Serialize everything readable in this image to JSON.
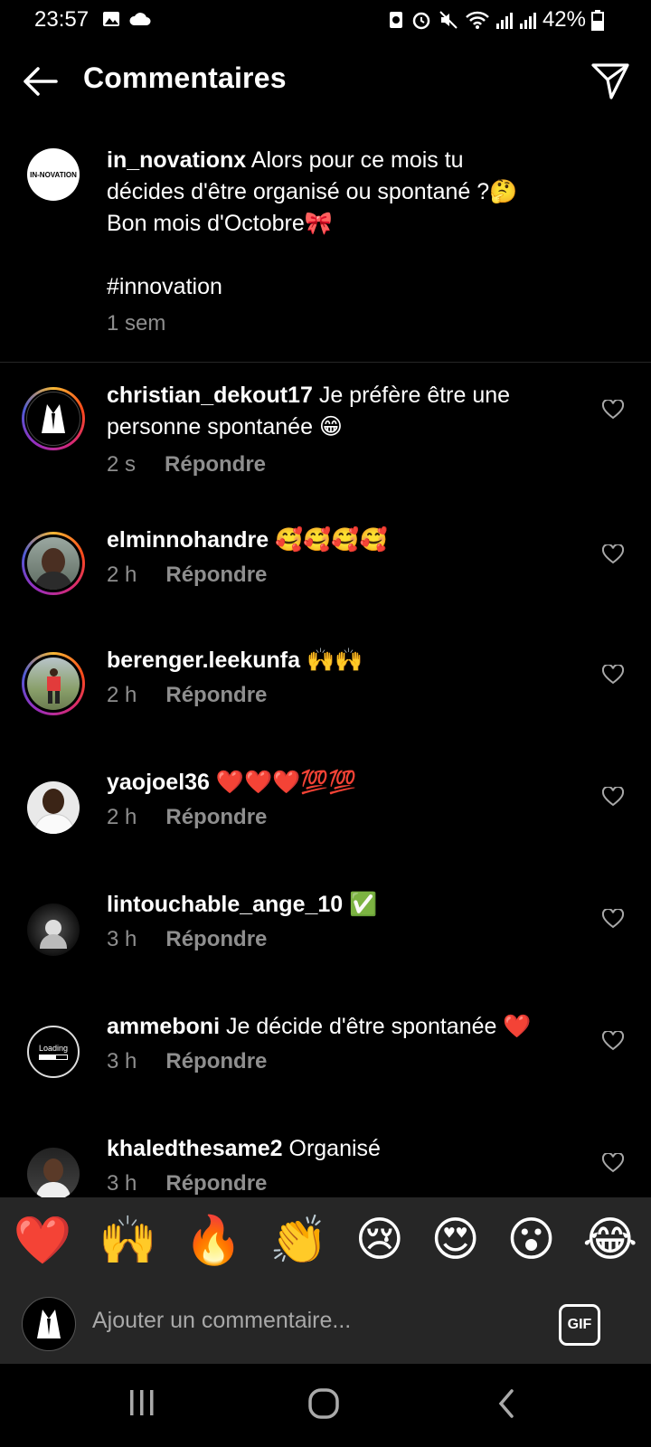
{
  "status_bar": {
    "time": "23:57",
    "battery": "42%"
  },
  "header": {
    "title": "Commentaires"
  },
  "caption": {
    "username": "in_novationx",
    "line1": "Alors pour ce mois tu",
    "line2": "décides d'être organisé ou spontané ?🤔",
    "line3": "Bon mois d'Octobre🎀",
    "hashtag": "#innovation",
    "time": "1 sem",
    "avatar_text": "IN-NOVATION"
  },
  "comments": [
    {
      "username": "christian_dekout17",
      "text": "Je préfère être une",
      "text2": "personne spontanée 😁",
      "time": "2 s",
      "reply": "Répondre"
    },
    {
      "username": "elminnohandre",
      "text": "🥰🥰🥰🥰",
      "time": "2 h",
      "reply": "Répondre"
    },
    {
      "username": "berenger.leekunfa",
      "text": "🙌🙌",
      "time": "2 h",
      "reply": "Répondre"
    },
    {
      "username": "yaojoel36",
      "text": "❤️❤️❤️💯💯",
      "time": "2 h",
      "reply": "Répondre"
    },
    {
      "username": "lintouchable_ange_10",
      "text": "✅",
      "time": "3 h",
      "reply": "Répondre"
    },
    {
      "username": "ammeboni",
      "text": "Je décide d'être spontanée ❤️",
      "time": "3 h",
      "reply": "Répondre",
      "avatar_text": "Loading"
    },
    {
      "username": "khaledthesame2",
      "text": "Organisé",
      "time": "3 h",
      "reply": "Répondre"
    }
  ],
  "quick_emojis": [
    "❤️",
    "🙌",
    "🔥",
    "👏",
    "😢",
    "😍",
    "😮",
    "😂"
  ],
  "composer": {
    "placeholder": "Ajouter un commentaire...",
    "gif_label": "GIF"
  }
}
